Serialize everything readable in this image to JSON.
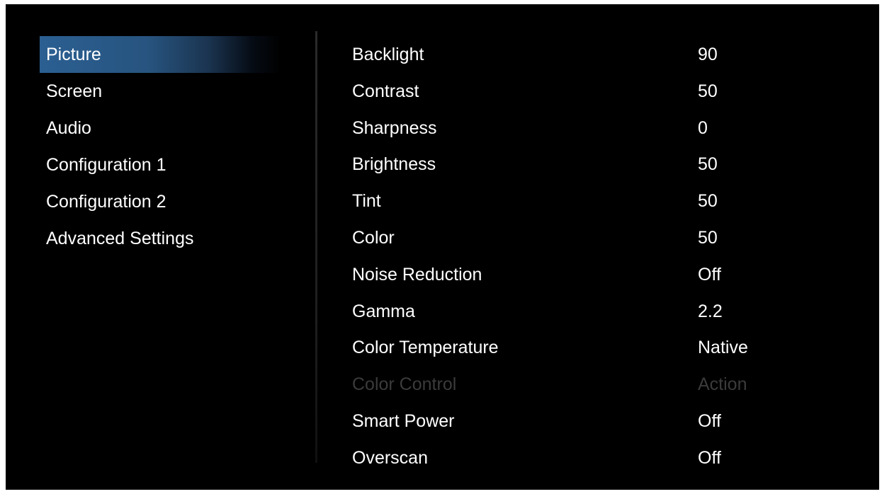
{
  "menu": {
    "items": [
      {
        "label": "Picture",
        "active": true
      },
      {
        "label": "Screen"
      },
      {
        "label": "Audio"
      },
      {
        "label": "Configuration 1"
      },
      {
        "label": "Configuration 2"
      },
      {
        "label": "Advanced Settings"
      }
    ]
  },
  "settings": {
    "rows": [
      {
        "label": "Backlight",
        "value": "90"
      },
      {
        "label": "Contrast",
        "value": "50"
      },
      {
        "label": "Sharpness",
        "value": "0"
      },
      {
        "label": "Brightness",
        "value": "50"
      },
      {
        "label": "Tint",
        "value": "50"
      },
      {
        "label": "Color",
        "value": "50"
      },
      {
        "label": "Noise Reduction",
        "value": "Off"
      },
      {
        "label": "Gamma",
        "value": "2.2"
      },
      {
        "label": "Color Temperature",
        "value": "Native"
      },
      {
        "label": "Color Control",
        "value": "Action",
        "disabled": true
      },
      {
        "label": "Smart Power",
        "value": "Off"
      },
      {
        "label": "Overscan",
        "value": "Off"
      }
    ]
  },
  "colors": {
    "background": "#000000",
    "text": "#ffffff",
    "disabled_text": "#3b3b3b",
    "highlight": "#2b5f92"
  }
}
